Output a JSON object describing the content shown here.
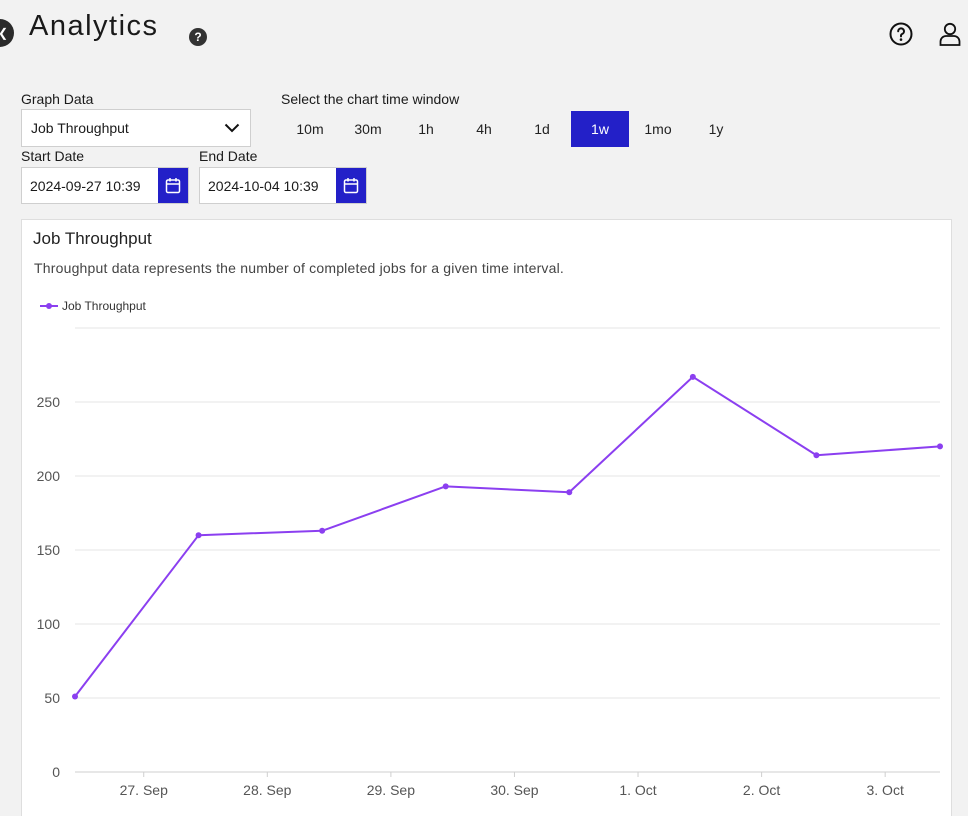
{
  "header": {
    "title": "Analytics",
    "help_glyph": "?",
    "icons": [
      "help-circle-icon",
      "user-icon"
    ]
  },
  "controls": {
    "graph_data_label": "Graph Data",
    "graph_data_value": "Job Throughput",
    "time_window_label": "Select the chart time window",
    "time_windows": [
      "10m",
      "30m",
      "1h",
      "4h",
      "1d",
      "1w",
      "1mo",
      "1y"
    ],
    "active_window": "1w",
    "start_date_label": "Start Date",
    "start_date_value": "2024-09-27 10:39",
    "end_date_label": "End Date",
    "end_date_value": "2024-10-04 10:39"
  },
  "colors": {
    "accent": "#2320c8",
    "series": "#8b3ff0"
  },
  "chart_data": {
    "type": "line",
    "title": "Job Throughput",
    "subtitle": "Throughput data represents the number of completed jobs for a given time interval.",
    "x_tick_labels": [
      "27. Sep",
      "28. Sep",
      "29. Sep",
      "30. Sep",
      "1. Oct",
      "2. Oct",
      "3. Oct"
    ],
    "y_ticks": [
      0,
      50,
      100,
      150,
      200,
      250
    ],
    "xlim": [
      "2024-09-27 10:39",
      "2024-10-04 10:39"
    ],
    "ylim": [
      0,
      300
    ],
    "grid": true,
    "legend": "top-left",
    "series": [
      {
        "name": "Job Throughput",
        "x": [
          "2024-09-27 10:39",
          "2024-09-28 10:39",
          "2024-09-29 10:39",
          "2024-09-30 10:39",
          "2024-10-01 10:39",
          "2024-10-02 10:39",
          "2024-10-03 10:39",
          "2024-10-04 10:39"
        ],
        "values": [
          51,
          160,
          163,
          193,
          189,
          267,
          214,
          220
        ]
      }
    ]
  }
}
